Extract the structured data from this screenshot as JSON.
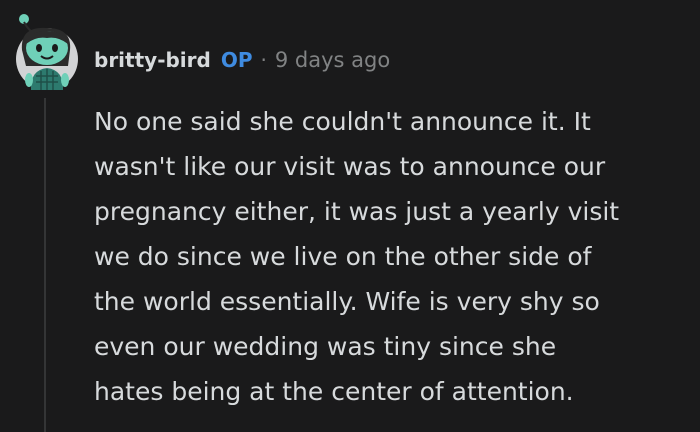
{
  "comment": {
    "author": "britty-bird",
    "op_badge": "OP",
    "separator": "·",
    "timestamp": "9 days ago",
    "avatar_icon": "snoo-avatar-icon",
    "body_lines": [
      "No one said she couldn't announce it. It",
      "wasn't like our visit was to announce our",
      "pregnancy either, it was just a yearly visit",
      "we do since we live on the other side of",
      "the world essentially. Wife is very shy so",
      "even our wedding was tiny since she",
      "hates being at the center of attention."
    ]
  },
  "colors": {
    "background": "#1a1a1b",
    "text": "#d7dadc",
    "meta": "#818384",
    "op": "#3f8be0",
    "thread_line": "#343536"
  }
}
